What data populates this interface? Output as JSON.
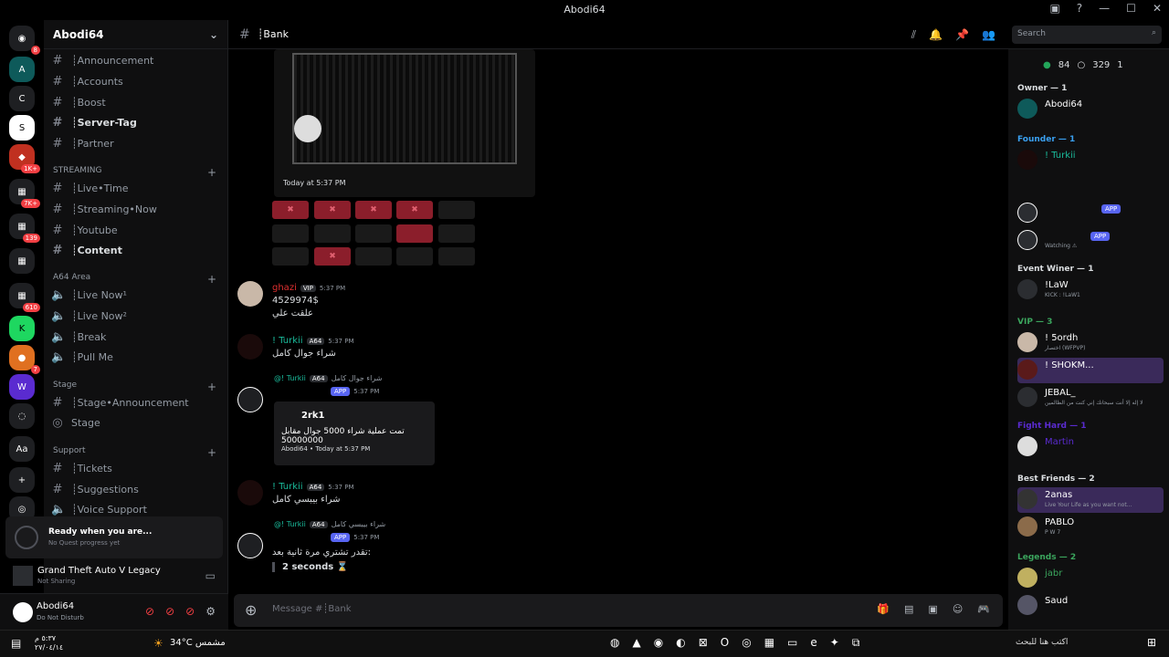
{
  "window": {
    "title": "Abodi64"
  },
  "guild": {
    "name": "Abodi64"
  },
  "channels": {
    "items": [
      {
        "label": "┊Announcement",
        "top": 0
      },
      {
        "label": "┊Accounts"
      },
      {
        "label": "┊Boost"
      },
      {
        "label": "┊Server-Tag"
      },
      {
        "label": "┊Partner"
      }
    ],
    "streaming_cat": "STREAMING",
    "streaming": [
      "┊Live•Time",
      "┊Streaming•Now",
      "┊Youtube",
      "┊Content"
    ],
    "a64_cat": "A64 Area",
    "a64": [
      "┊Live Now¹",
      "┊Live Now²",
      "┊Break",
      "┊Pull Me"
    ],
    "stage_cat": "Stage",
    "stage": [
      "┊Stage•Announcement",
      "Stage"
    ],
    "support_cat": "Support",
    "support": [
      "┊Tickets",
      "┊Suggestions",
      "┊Voice Support"
    ]
  },
  "quest": {
    "title": "Ready when you are...",
    "subtitle": "No Quest progress yet"
  },
  "activity": {
    "game": "Grand Theft Auto V Legacy",
    "status": "Not Sharing"
  },
  "user": {
    "name": "Abodi64",
    "status": "Do Not Disturb"
  },
  "chat_header": {
    "channel": "┊Bank",
    "search_placeholder": "Search"
  },
  "image_embed": {
    "timestamp": "Today at 5:37 PM"
  },
  "messages": [
    {
      "author": "ghazi",
      "tag": "VIP",
      "time": "5:37 PM",
      "lines": [
        "4529974$",
        "علقت علي"
      ]
    },
    {
      "author": "! Turkii",
      "tag": "A64",
      "time": "5:37 PM",
      "lines": [
        "شراء جوال كامل"
      ]
    },
    {
      "reply_author": "@! Turkii",
      "reply_tag": "A64",
      "reply_text": "شراء جوال كامل",
      "app": "APP",
      "time": "5:37 PM",
      "embed": {
        "title": "2rk1",
        "body": "تمت عملية شراء 5000 جوال مقابل 50000000",
        "footer": "Abodi64 • Today at 5:37 PM"
      }
    },
    {
      "author": "! Turkii",
      "tag": "A64",
      "time": "5:37 PM",
      "lines": [
        "شراء بيبسي كامل"
      ]
    },
    {
      "reply_author": "@! Turkii",
      "reply_tag": "A64",
      "reply_text": "شراء بيبسي كامل",
      "app": "APP",
      "time": "5:37 PM",
      "lines": [
        "تقدر تشتري مرة ثانية بعد:",
        "2 seconds ⌛"
      ]
    }
  ],
  "composer": {
    "placeholder": "Message #┊Bank"
  },
  "members": {
    "online": "84",
    "offline": "329",
    "other": "1",
    "groups": [
      {
        "label": "Owner — 1"
      },
      {
        "label": "Founder — 1"
      },
      {
        "label": "Event Winer — 1"
      },
      {
        "label": "VIP — 3"
      },
      {
        "label": "Fight Hard — 1"
      },
      {
        "label": "Best Friends — 2"
      },
      {
        "label": "Legends — 2"
      }
    ],
    "list": [
      {
        "name": "Abodi64",
        "tag": "A64"
      },
      {
        "name": "! Turkii",
        "tag": "A64"
      },
      {
        "name": "",
        "tag": "APP"
      },
      {
        "name": "",
        "status": "Watching ⚠",
        "tag": "APP"
      },
      {
        "name": "!LaW",
        "tag": "MT",
        "status": "KICK : !LaW1"
      },
      {
        "name": "! 5ordh",
        "tag": "WF",
        "status": "اختصار (WFPVP)"
      },
      {
        "name": "! SHOKM...",
        "tag": "KY"
      },
      {
        "name": "JEBAL_",
        "tag": "JBL",
        "status": "لا إله إلا أنت سبحانك إني كنت من الظالمين"
      },
      {
        "name": "Martin",
        "tag": "PR"
      },
      {
        "name": "2anas",
        "tag": "2 A",
        "status": "Live Your Life as you want not..."
      },
      {
        "name": "PABLO",
        "tag": "KY",
        "status": "P W 7"
      },
      {
        "name": "jabr"
      },
      {
        "name": "Saud"
      }
    ]
  },
  "taskbar": {
    "weather": "34°C  مشمس",
    "search": "اكتب هنا للبحث",
    "time": "٥:٣٧ م",
    "date": "٢٧/٠٤/١٤"
  }
}
